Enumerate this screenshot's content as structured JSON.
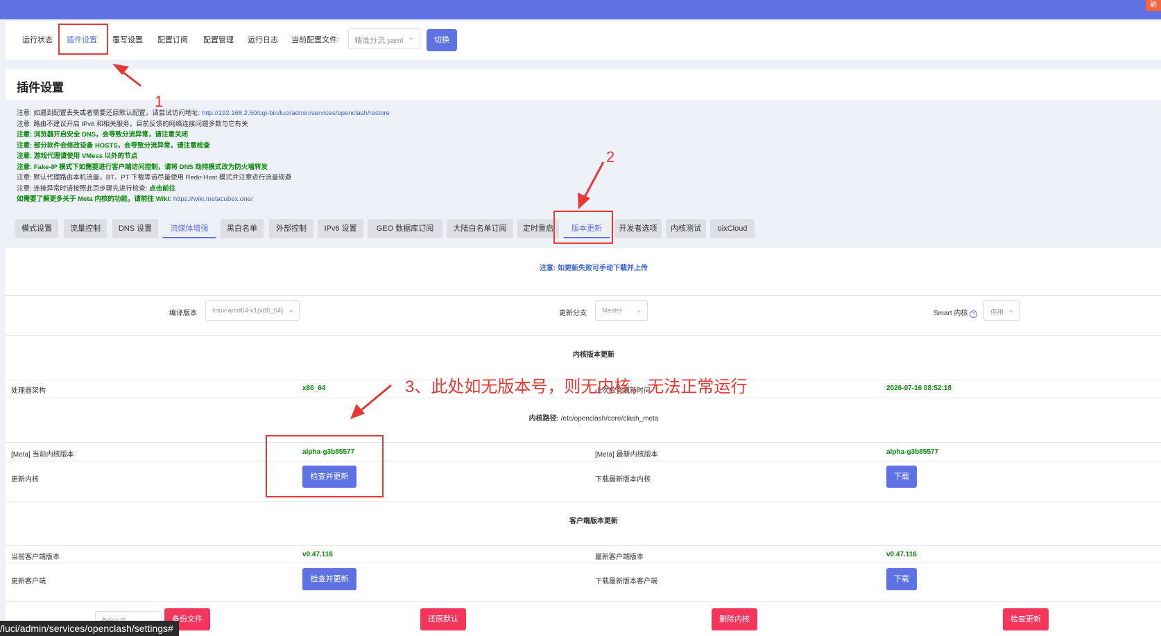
{
  "nav": {
    "items": [
      "运行状态",
      "插件设置",
      "覆写设置",
      "配置订阅",
      "配置管理",
      "运行日志"
    ],
    "config_label": "当前配置文件:",
    "config_value": "精准分流.yaml",
    "switch_label": "切换"
  },
  "topbar_badge": "刷",
  "page_title": "插件设置",
  "notes": [
    {
      "text": "注意: 如遇到配置丢失或者需要还原默认配置，请尝试访问地址: ",
      "link": "http://192.168.2.50/cgi-bin/luci/admin/services/openclash/restore",
      "style": "normal"
    },
    {
      "text": "注意: 路由不建议开启 IPv6 和相关服务，目前反馈的网络连接问题多数与它有关",
      "style": "normal"
    },
    {
      "text": "注意: 浏览器开启安全 DNS，会导致分流异常，请注意关闭",
      "style": "green"
    },
    {
      "text": "注意: 部分软件会修改设备 HOSTS，会导致分流异常，请注意检查",
      "style": "green"
    },
    {
      "text": "注意: 游戏代理请使用 VMess 以外的节点",
      "style": "green"
    },
    {
      "text": "注意: Fake-IP 模式下如需要进行客户端访问控制，请将 DNS 劫持模式改为防火墙转发",
      "style": "green"
    },
    {
      "text": "注意: 默认代理路由本机流量，BT、PT 下载等请尽量使用 Redir-Host 模式并注意进行流量规避",
      "style": "normal"
    },
    {
      "text": "注意: 连接异常时请按照此页步骤先进行检查: ",
      "link": "点击前往",
      "style": "normal"
    },
    {
      "text": "如需要了解更多关于 Meta 内核的功能，请前往 Wiki: ",
      "link": "https://wiki.metacubex.one/",
      "style": "green"
    }
  ],
  "tabs": [
    "模式设置",
    "流量控制",
    "DNS 设置",
    "流媒体增强",
    "黑白名单",
    "外部控制",
    "IPv6 设置",
    "GEO 数据库订阅",
    "大陆白名单订阅",
    "定时重启",
    "版本更新",
    "开发者选项",
    "内核测试",
    "oixCloud"
  ],
  "panel": {
    "notice": "注意: 如更新失败可手动下载并上传",
    "compile_label": "编译版本",
    "compile_value": "linux-amd64-v1(x86_64)",
    "branch_label": "更新分支",
    "branch_value": "Master",
    "smart_label": "Smart 内核",
    "smart_value": "停用",
    "core_title": "内核版本更新",
    "arch_label": "处理器架构",
    "arch_value": "x86_64",
    "last_check_label": "上次检查更新时间",
    "last_check_value": "2026-07-16 08:52:18",
    "core_path_label": "内核路径:",
    "core_path_value": "/etc/openclash/core/clash_meta",
    "current_core_label": "[Meta] 当前内核版本",
    "current_core_value": "alpha-g3b85577",
    "latest_core_label": "[Meta] 最新内核版本",
    "latest_core_value": "alpha-g3b85577",
    "update_core_label": "更新内核",
    "check_update_btn": "检查并更新",
    "download_core_label": "下载最新版本内核",
    "download_btn": "下载",
    "client_title": "客户端版本更新",
    "current_client_label": "当前客户端版本",
    "current_client_value": "v0.47.116",
    "latest_client_label": "最新客户端版本",
    "latest_client_value": "v0.47.116",
    "update_client_label": "更新客户端",
    "download_client_label": "下载最新版本客户端",
    "partial_input_placeholder": "备份内容",
    "backup_btn": "备份文件",
    "restore_btn": "还原默认",
    "delete_core_btn": "删除内核",
    "check_btn": "检查更新"
  },
  "annotations": {
    "n1": "1",
    "n2": "2",
    "n3": "3、此处如无版本号，则无内核，无法正常运行"
  },
  "statusbar": "/luci/admin/services/openclash/settings#"
}
